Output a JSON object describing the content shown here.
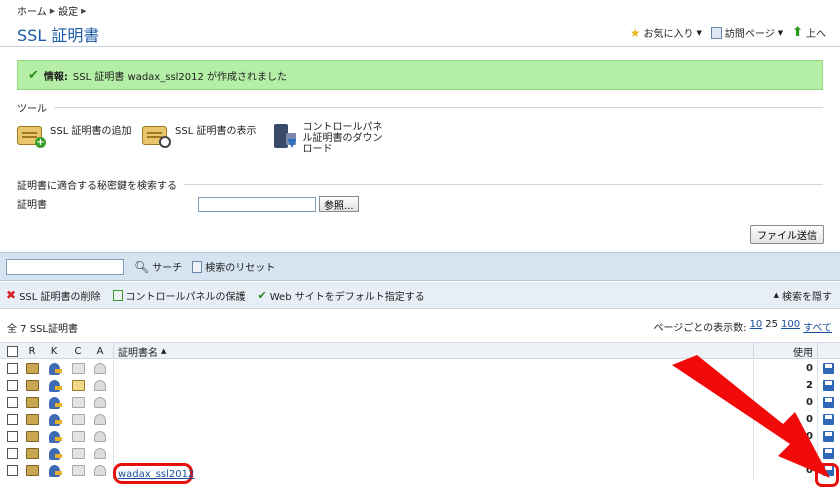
{
  "header": {
    "breadcrumb": [
      "ホーム",
      "設定"
    ],
    "title": "SSL 証明書",
    "favorites": "お気に入り",
    "visited_pages": "訪問ページ",
    "up": "上へ"
  },
  "message": {
    "label": "情報:",
    "text": "SSL 証明書 wadax_ssl2012 が作成されました"
  },
  "tools": {
    "section_title": "ツール",
    "items": [
      "SSL 証明書の追加",
      "SSL 証明書の表示",
      "コントロールパネル証明書のダウンロード"
    ]
  },
  "keysearch": {
    "section_title": "証明書に適合する秘密鍵を検索する",
    "file_label": "証明書",
    "browse": "参照...",
    "submit": "ファイル送信"
  },
  "searchbar": {
    "search": "サーチ",
    "reset": "検索のリセット"
  },
  "actions": {
    "delete": "SSL 証明書の削除",
    "protect": "コントロールパネルの保護",
    "default": "Web サイトをデフォルト指定する",
    "hide_search": "検索を隠す"
  },
  "list": {
    "total": "全 7 SSL証明書",
    "per_page_label": "ページごとの表示数:",
    "per_page_10": "10",
    "per_page_25": "25",
    "per_page_100": "100",
    "per_page_all": "すべて"
  },
  "table": {
    "headers": {
      "r": "R",
      "k": "K",
      "c": "C",
      "a": "A",
      "name": "証明書名",
      "usage": "使用"
    },
    "rows": [
      {
        "name": "",
        "usage": "0",
        "c_active": false
      },
      {
        "name": "",
        "usage": "2",
        "c_active": true
      },
      {
        "name": "",
        "usage": "0",
        "c_active": false
      },
      {
        "name": "",
        "usage": "0",
        "c_active": false
      },
      {
        "name": "",
        "usage": "0",
        "c_active": false
      },
      {
        "name": "",
        "usage": "0",
        "c_active": false
      },
      {
        "name": "wadax_ssl2012",
        "usage": "0",
        "c_active": false
      }
    ]
  },
  "colors": {
    "accent": "#1c5aa6",
    "success_bg": "#b5efa7",
    "annotation": "#e80f0f"
  }
}
